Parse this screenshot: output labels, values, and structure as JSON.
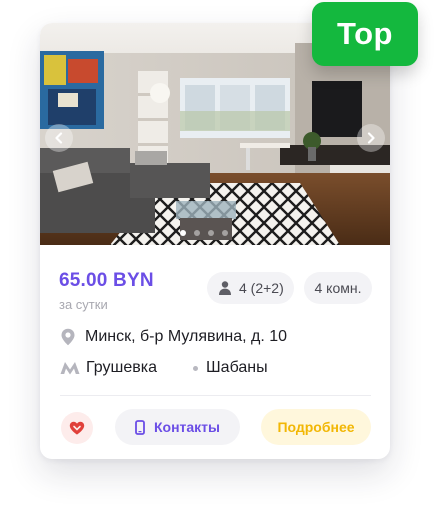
{
  "listing": {
    "price": "65.00 BYN",
    "price_period": "за сутки",
    "guests": "4 (2+2)",
    "rooms": "4 комн.",
    "address": "Минск, б-р Мулявина, д. 10",
    "metro_station": "Грушевка",
    "district": "Шабаны"
  },
  "badge": {
    "label": "Top",
    "color": "#14b83e"
  },
  "gallery": {
    "total_slides": 4,
    "active_slide": 1
  },
  "actions": {
    "contacts_label": "Контакты",
    "details_label": "Подробнее"
  },
  "colors": {
    "accent": "#6b4ee6",
    "details": "#f2b705",
    "favorite": "#e0403a"
  },
  "icons": {
    "prev": "chevron-left-icon",
    "next": "chevron-right-icon",
    "guests": "person-icon",
    "address": "location-pin-icon",
    "metro": "metro-icon",
    "favorite": "heart-icon",
    "contacts": "phone-icon"
  }
}
